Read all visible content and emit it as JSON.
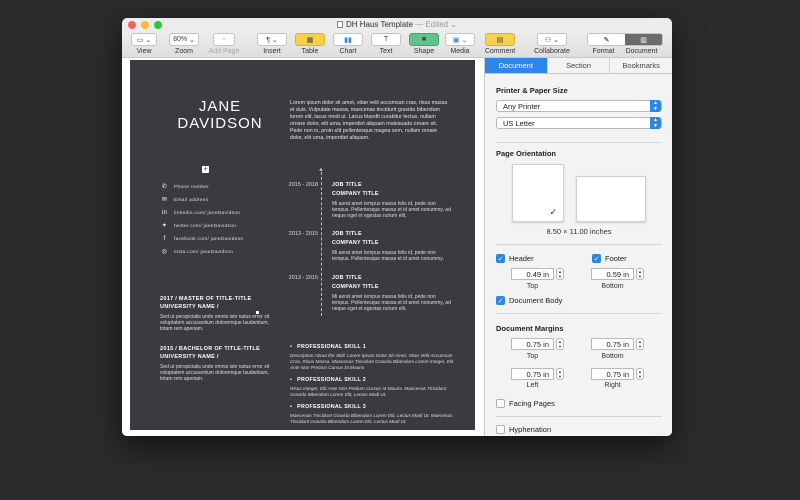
{
  "window": {
    "title": "DH Haus Template",
    "edited": "— Edited"
  },
  "toolbar": {
    "view": "View",
    "zoom_value": "80%",
    "zoom": "Zoom",
    "add_page": "Add Page",
    "insert": "Insert",
    "table": "Table",
    "chart": "Chart",
    "text": "Text",
    "shape": "Shape",
    "media": "Media",
    "comment": "Comment",
    "collaborate": "Collaborate",
    "format": "Format",
    "document": "Document"
  },
  "resume": {
    "first_name": "JANE",
    "last_name": "DAVIDSON",
    "intro": "Lorem ipsum dolor sit amet, vitae velit accumsan cras, risus massa et duis. Vulputate massa, maecenas tincidunt gravida bibendum lorem elit, lacus modi ut. Lacus blandit curabitur lectus, nullam ornare dolor, elit urna, imperdiet aliquam malesuada ornare sit. Pede non in, proin elit pellentesque magna sem, nullam ornare dolor, elit urna, imperdiet aliquam.",
    "contacts": [
      {
        "icon": "phone-icon",
        "glyph": "✆",
        "label": "Phone number"
      },
      {
        "icon": "email-icon",
        "glyph": "✉",
        "label": "Email address"
      },
      {
        "icon": "linkedin-icon",
        "glyph": "in",
        "label": "linkedin.com/ janeDavidson"
      },
      {
        "icon": "twitter-icon",
        "glyph": "✦",
        "label": "twitter.com/ janeDavidson"
      },
      {
        "icon": "facebook-icon",
        "glyph": "f",
        "label": "facebook.com/ janeDavidson"
      },
      {
        "icon": "instagram-icon",
        "glyph": "◎",
        "label": "insta.com/ janeDavidson"
      }
    ],
    "jobs": [
      {
        "date": "2015 - 2018",
        "title": "JOB TITLE",
        "company": "COMPANY TITLE",
        "desc": "Mi aerat amet tempus massa felis id, pede non tempus. Pellentesque massa et id amet nonummy, ad neque eget et egestas rutrum elit."
      },
      {
        "date": "2013 - 2015",
        "title": "JOB TITLE",
        "company": "COMPANY TITLE",
        "desc": "Mi aerat amet tempus massa felis id, pede non tempus. Pellentesque massa et id amet nonummy."
      },
      {
        "date": "2013 - 2015",
        "title": "JOB TITLE",
        "company": "COMPANY TITLE",
        "desc": "Mi aerat amet tempus massa felis id, pede non tempus. Pellentesque massa et id amet nonummy, ad neque eget et egestas rutrum elit."
      }
    ],
    "education": [
      {
        "line1": "2017 / MASTER OF TITLE-TITLE",
        "line2": "UNIVERSITY NAME /",
        "desc": "Sed ut perspiciatis unde omnis iste natus error sit voluptatem accusantium doloremque laudantium, totam rem aperiam."
      },
      {
        "line1": "2015 / BACHELOR OF TITLE-TITLE",
        "line2": "UNIVERSITY NAME /",
        "desc": "Sed ut perspiciatis unde omnis iste natus error sit voluptatem accusantium doloremque laudantium, totam rem aperiam."
      }
    ],
    "skills": [
      {
        "title": "PROFESSIONAL SKILL 1",
        "desc": "Description About the Skill. Lorem Ipsum Dolor Sit Amet, Vitae Velit Accumsan Cras, Risus Massa. Maecenas Tincidunt Gravida Bibendum Lorem Integer, Elit Ante Non Pretium Cursus Et Mauris."
      },
      {
        "title": "PROFESSIONAL SKILL 2",
        "desc": "Risus Integer, Elit Ante Non Pretium Cursus At Mauris. Maecenas Tincidunt Gravida Bibendum Lorem Elit, Lectus Modi Ut."
      },
      {
        "title": "PROFESSIONAL SKILL 3",
        "desc": "Maecenas Tincidunt Gravida Bibendum Lorem Elit, Lectus Modi Ut. Maecenas Tincidunt Gravida Bibendum Lorem Elit, Lectus Modi Ut."
      }
    ]
  },
  "sidebar": {
    "tabs": [
      "Document",
      "Section",
      "Bookmarks"
    ],
    "printer_title": "Printer & Paper Size",
    "printer": "Any Printer",
    "paper": "US Letter",
    "orientation_title": "Page Orientation",
    "paper_size": "8.50 × 11.00 inches",
    "header_label": "Header",
    "footer_label": "Footer",
    "header_value": "0.49 in",
    "footer_value": "0.59 in",
    "top": "Top",
    "bottom": "Bottom",
    "document_body": "Document Body",
    "margins_title": "Document Margins",
    "margin_top": "0.75 in",
    "margin_bottom": "0.75 in",
    "margin_left": "0.75 in",
    "margin_right": "0.75 in",
    "left": "Left",
    "right": "Right",
    "facing_pages": "Facing Pages",
    "hyphenation": "Hyphenation",
    "accent": "#2f86e6"
  }
}
